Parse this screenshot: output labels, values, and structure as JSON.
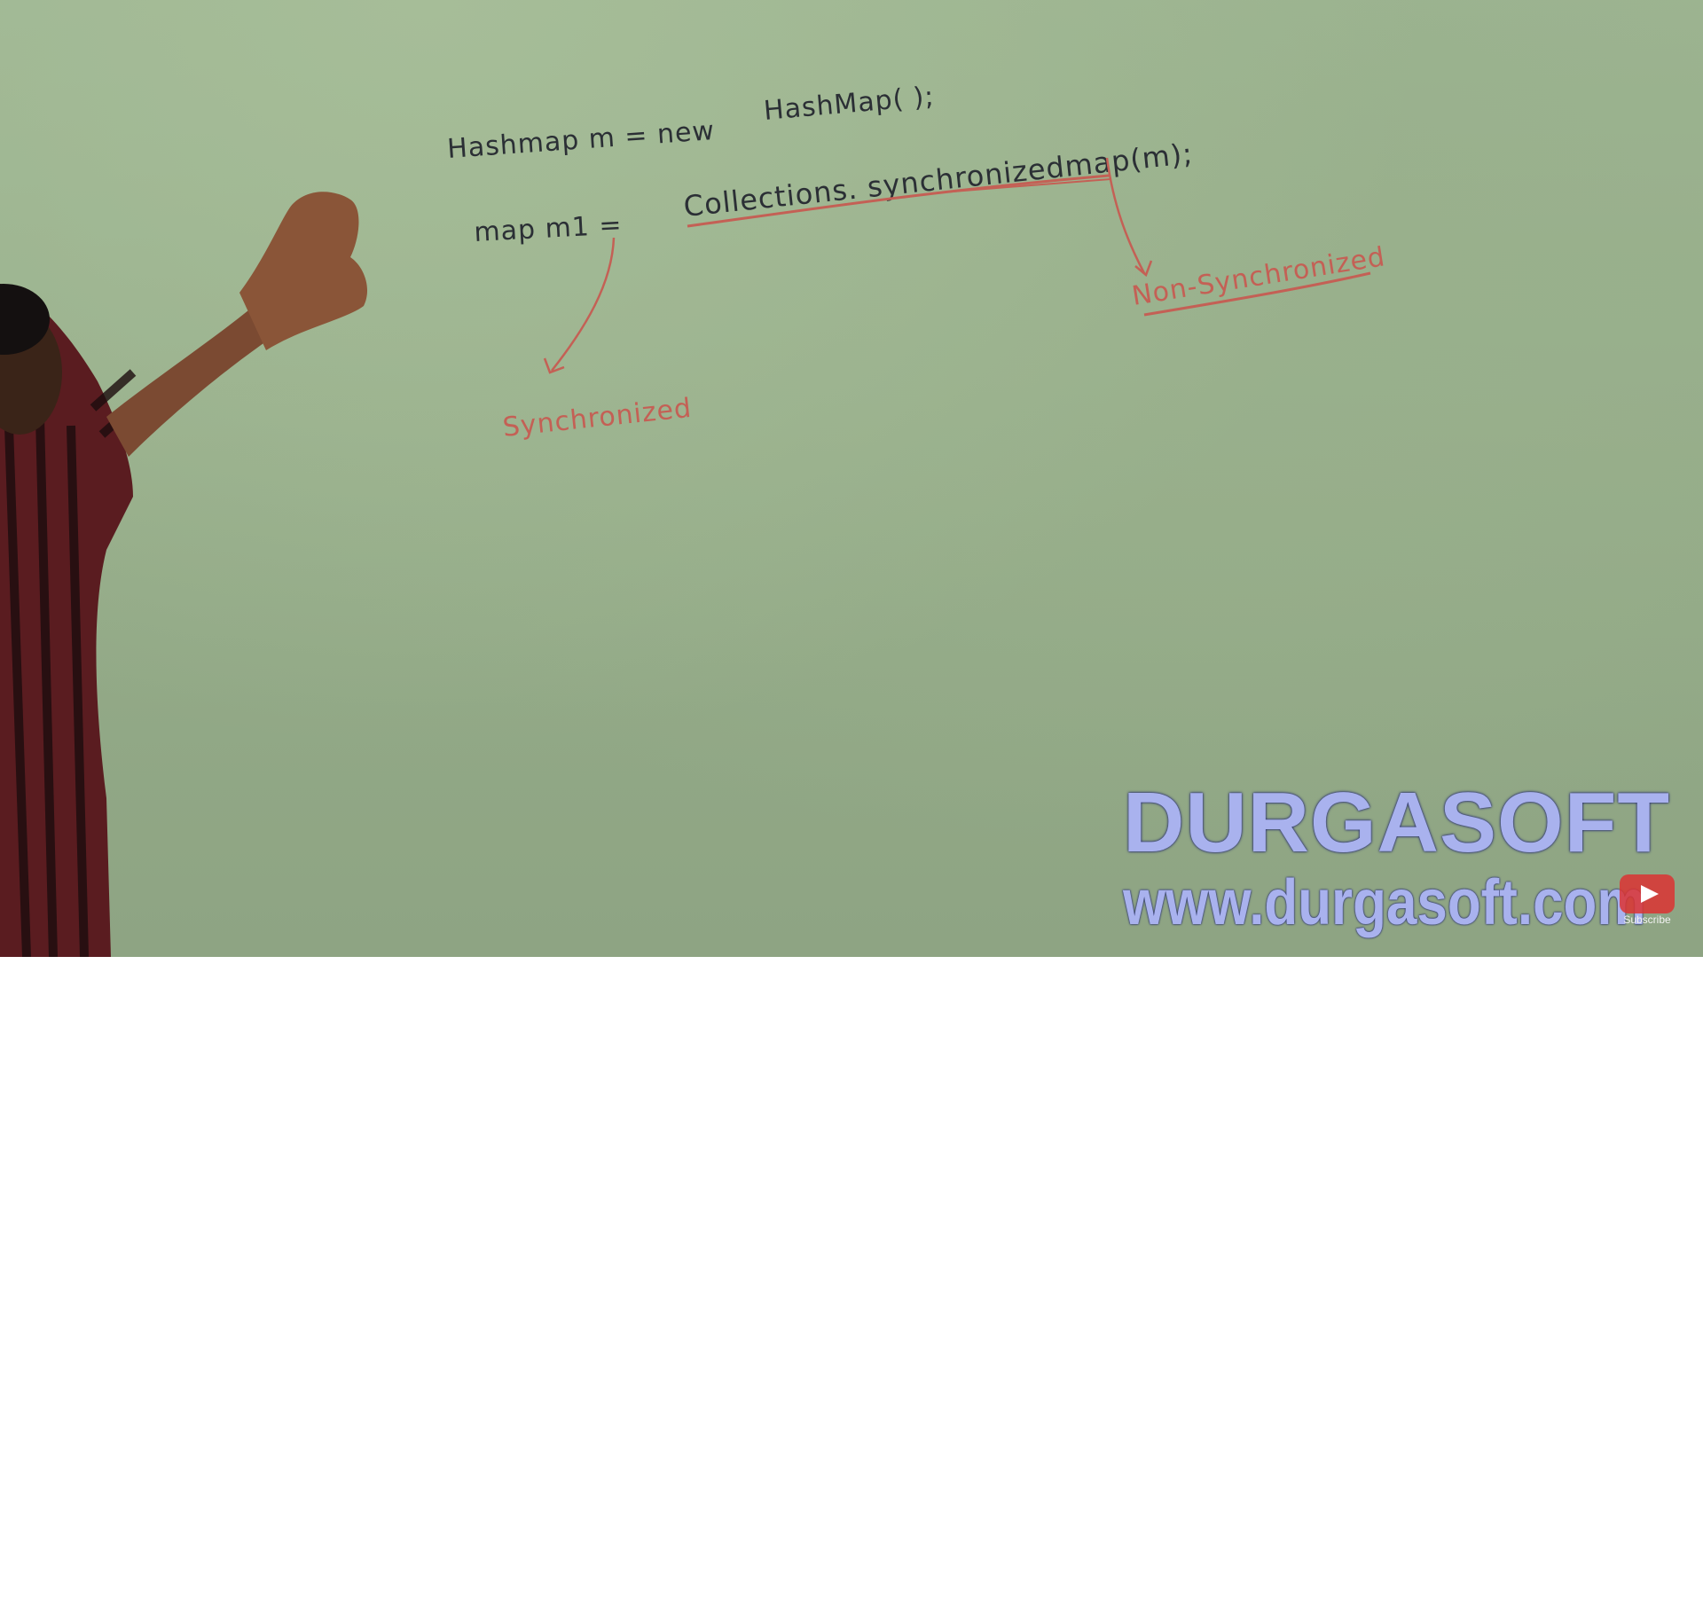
{
  "board": {
    "line1_left": "Hashmap  m = new",
    "line1_right": "HashMap( );",
    "line2_left": "map   m1 =",
    "line2_call": "Collections. synchronizedmap(m);",
    "label_left": "Synchronized",
    "label_right": "Non-Synchronized"
  },
  "watermark": {
    "brand": "DURGASOFT",
    "url": "www.durgasoft.com"
  },
  "youtube": {
    "subscribe_label": "Subscribe"
  },
  "colors": {
    "board": "#9db592",
    "marker_black": "#2b2f35",
    "marker_red": "#c46055",
    "watermark": "#a9b2ee"
  }
}
